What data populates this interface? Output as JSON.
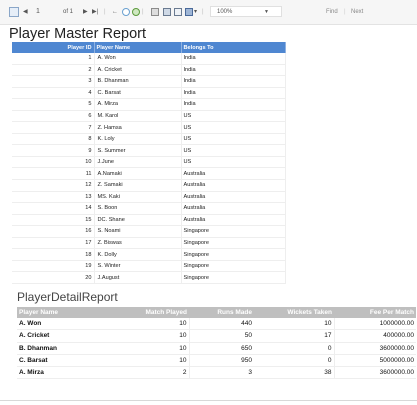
{
  "toolbar": {
    "page_current": "1",
    "page_of": "of 1",
    "zoom": "100%",
    "find_label": "Find",
    "separator": "|",
    "next_label": "Next"
  },
  "master_report": {
    "title": "Player Master Report",
    "columns": [
      "Player ID",
      "Player Name",
      "Belongs To"
    ],
    "rows": [
      [
        "1",
        "A. Won",
        "India"
      ],
      [
        "2",
        "A. Cricket",
        "India"
      ],
      [
        "3",
        "B. Dhanman",
        "India"
      ],
      [
        "4",
        "C. Barsat",
        "India"
      ],
      [
        "5",
        "A. Mirza",
        "India"
      ],
      [
        "6",
        "M. Karol",
        "US"
      ],
      [
        "7",
        "Z. Hamsa",
        "US"
      ],
      [
        "8",
        "K. Loly",
        "US"
      ],
      [
        "9",
        "S. Summer",
        "US"
      ],
      [
        "10",
        "J.June",
        "US"
      ],
      [
        "11",
        "A.Namaki",
        "Australia"
      ],
      [
        "12",
        "Z. Samaki",
        "Australia"
      ],
      [
        "13",
        "MS. Kaki",
        "Australia"
      ],
      [
        "14",
        "S. Boon",
        "Australia"
      ],
      [
        "15",
        "DC. Shane",
        "Australia"
      ],
      [
        "16",
        "S. Noami",
        "Singapore"
      ],
      [
        "17",
        "Z. Biswas",
        "Singapore"
      ],
      [
        "18",
        "K. Dolly",
        "Singapore"
      ],
      [
        "19",
        "S. Winter",
        "Singapore"
      ],
      [
        "20",
        "J.August",
        "Singapore"
      ]
    ]
  },
  "detail_report": {
    "title": "PlayerDetailReport",
    "columns": [
      "Player Name",
      "Match Played",
      "Runs Made",
      "Wickets Taken",
      "Fee Per Match"
    ],
    "rows": [
      [
        "A. Won",
        "10",
        "440",
        "10",
        "1000000.00"
      ],
      [
        "A. Cricket",
        "10",
        "50",
        "17",
        "400000.00"
      ],
      [
        "B. Dhanman",
        "10",
        "650",
        "0",
        "3600000.00"
      ],
      [
        "C. Barsat",
        "10",
        "950",
        "0",
        "5000000.00"
      ],
      [
        "A. Mirza",
        "2",
        "3",
        "38",
        "3600000.00"
      ]
    ]
  },
  "colors": {
    "master_header": "#4f87d1",
    "detail_header": "#bfbfbf"
  }
}
